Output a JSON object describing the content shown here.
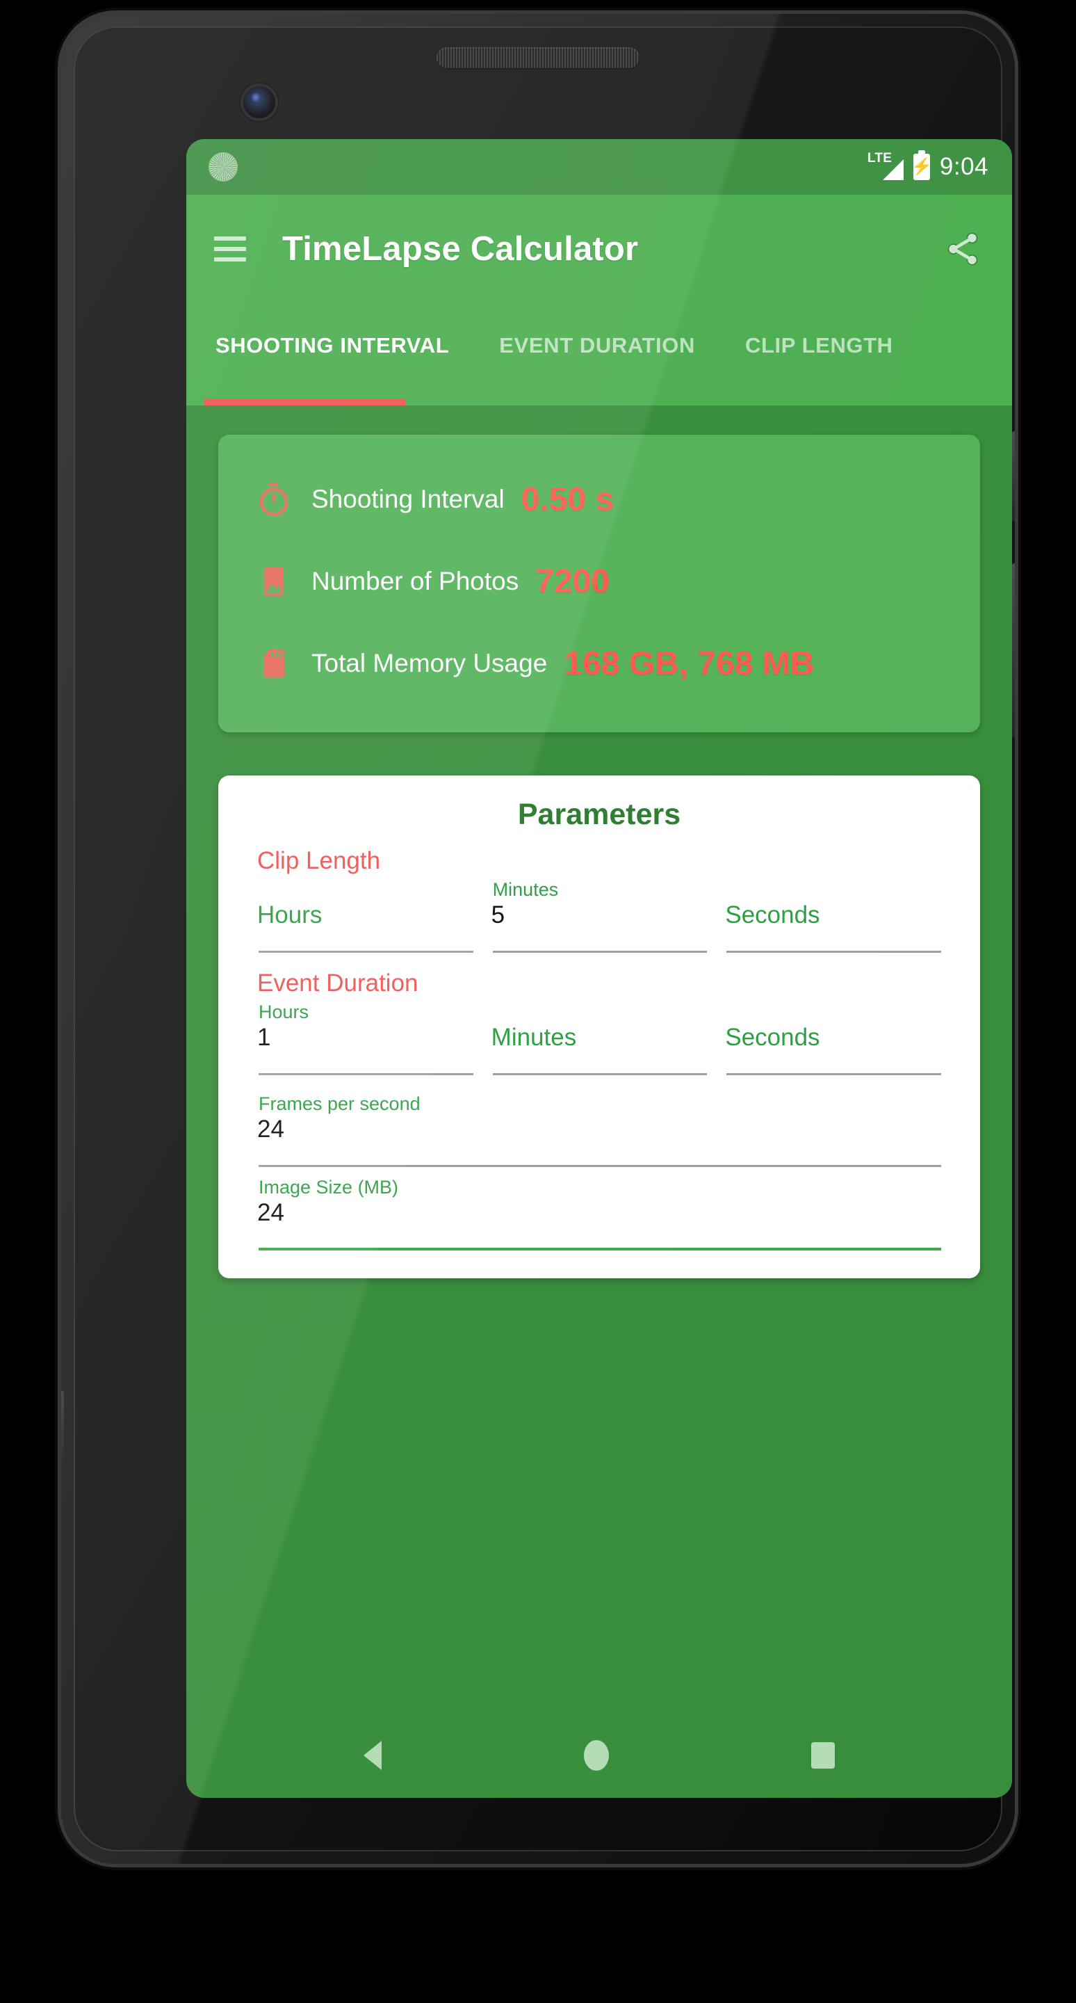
{
  "status_bar": {
    "network_label": "LTE",
    "time": "9:04",
    "signal_icon": "signal-triangle-icon",
    "battery_icon": "battery-charging-icon",
    "left_indicator_icon": "status-dot-icon"
  },
  "app_bar": {
    "menu_icon": "hamburger-menu-icon",
    "title": "TimeLapse Calculator",
    "share_icon": "share-icon"
  },
  "tabs": [
    {
      "label": "SHOOTING INTERVAL",
      "active": true
    },
    {
      "label": "EVENT DURATION",
      "active": false
    },
    {
      "label": "CLIP LENGTH",
      "active": false
    }
  ],
  "results": {
    "rows": [
      {
        "icon": "stopwatch-icon",
        "label": "Shooting Interval",
        "value": "0.50 s"
      },
      {
        "icon": "photo-image-icon",
        "label": "Number of Photos",
        "value": "7200"
      },
      {
        "icon": "sd-card-icon",
        "label": "Total Memory Usage",
        "value": "168 GB, 768 MB"
      }
    ]
  },
  "parameters": {
    "title": "Parameters",
    "clip_length": {
      "heading": "Clip Length",
      "hours": {
        "label": "Hours",
        "value": ""
      },
      "minutes": {
        "label": "Minutes",
        "value": "5"
      },
      "seconds": {
        "label": "Seconds",
        "value": ""
      }
    },
    "event_duration": {
      "heading": "Event Duration",
      "hours": {
        "label": "Hours",
        "value": "1"
      },
      "minutes": {
        "label": "Minutes",
        "value": ""
      },
      "seconds": {
        "label": "Seconds",
        "value": ""
      }
    },
    "frames_per_second": {
      "label": "Frames per second",
      "value": "24"
    },
    "image_size": {
      "label": "Image Size (MB)",
      "value": "24"
    }
  },
  "nav_bar": {
    "back_icon": "back-triangle-icon",
    "home_icon": "home-circle-icon",
    "recents_icon": "recents-square-icon"
  },
  "colors": {
    "primary_green": "#4caf50",
    "dark_green": "#388e3c",
    "card_green": "#54b259",
    "accent_red": "#ff5a4d",
    "heading_red": "#ef5350",
    "label_green": "#2e9e43",
    "title_green": "#2e7d32"
  }
}
